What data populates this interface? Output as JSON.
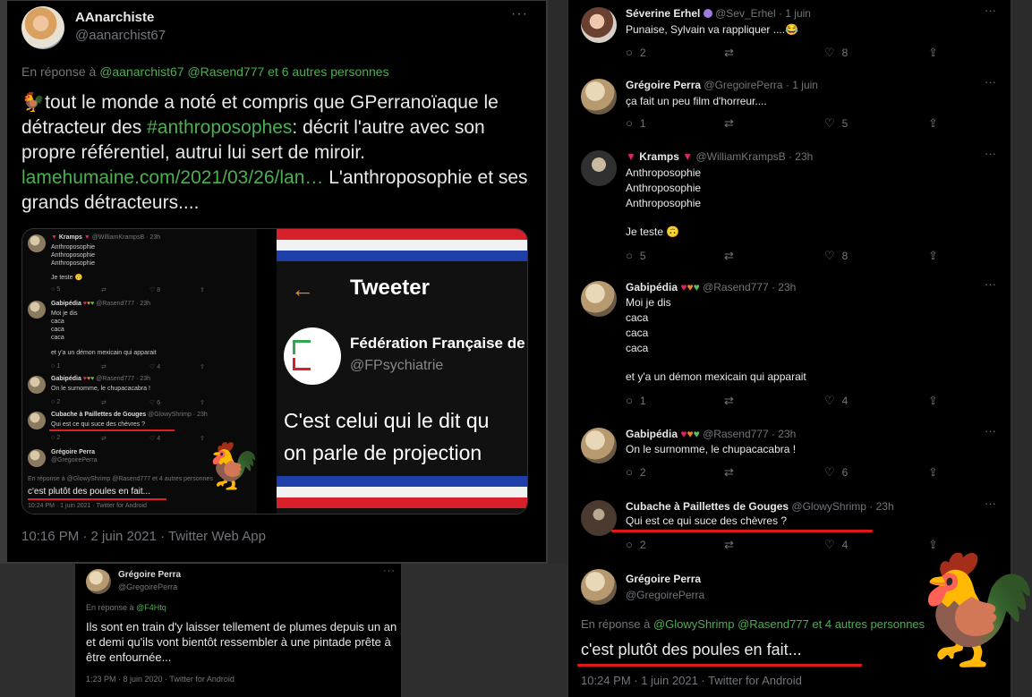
{
  "main_tweet": {
    "name": "AAnarchiste",
    "handle": "@aanarchist67",
    "reply_prefix": "En réponse à",
    "reply_mentions": "@aanarchist67 @Rasend777",
    "reply_more": "et 6 autres personnes",
    "text_part1": "🐓tout le monde a noté et compris que GPerranoïaque le détracteur des",
    "hashtag": "#anthroposophes",
    "text_part2": ": décrit l'autre avec son propre référentiel, autrui lui sert de miroir.",
    "link": "lamehumaine.com/2021/03/26/lan…",
    "text_part3": "L'anthroposophie et ses grands détracteurs....",
    "footer": "10:16 PM · 2 juin 2021 · Twitter Web App"
  },
  "media_mini": {
    "t1_name": "Kramps",
    "t1_handle": "@WilliamKrampsB · 23h",
    "t1_l1": "Anthroposophie",
    "t1_l2": "Anthroposophie",
    "t1_l3": "Anthroposophie",
    "t1_l4": "Je teste 🙃",
    "t1_counts": "5",
    "t1_likes": "8",
    "t2_name": "Gabipédia",
    "t2_handle": "@Rasend777 · 23h",
    "t2_l1": "Moi je dis",
    "t2_l2": "caca",
    "t2_l3": "caca",
    "t2_l4": "caca",
    "t2_l5": "et y'a un démon mexicain qui apparait",
    "t2_counts": "1",
    "t2_likes": "4",
    "t3_name": "Gabipédia",
    "t3_handle": "@Rasend777 · 23h",
    "t3_l1": "On le surnomme, le chupacacabra !",
    "t3_counts": "2",
    "t3_likes": "6",
    "t4_name": "Cubache à Paillettes de Gouges",
    "t4_handle": "@GlowyShrimp · 23h",
    "t4_l1": "Qui est ce qui suce des chèvres ?",
    "t4_counts": "2",
    "t4_likes": "4",
    "t5_name": "Grégoire Perra",
    "t5_handle": "@GregoirePerra",
    "t5_reply": "En réponse à @GlowyShrimp @Rasend777 et 4 autres personnes",
    "t5_text": "c'est plutôt des poules en fait...",
    "t5_footer": "10:24 PM · 1 juin 2021 · Twitter for Android"
  },
  "media_ff": {
    "back": "←",
    "title": "Tweeter",
    "org_name": "Fédération Française de",
    "org_handle": "@FPsychiatrie",
    "quote_l1": "C'est celui qui le dit qu",
    "quote_l2": "on parle de projection"
  },
  "small_tweet": {
    "name": "Grégoire Perra",
    "handle": "@GregoirePerra",
    "reply_prefix": "En réponse à",
    "reply_mention": "@F4Htq",
    "text": "Ils sont en train d'y laisser tellement de plumes depuis un an et demi qu'ils vont bientôt ressembler à une pintade prête à être enfournée...",
    "footer": "1:23 PM · 8 juin 2020 · Twitter for Android"
  },
  "thread": {
    "t1": {
      "name": "Séverine Erhel",
      "handle": "@Sev_Erhel · 1 juin",
      "text": "Punaise, Sylvain va rappliquer ....😂",
      "replies": "2",
      "retweets": "",
      "likes": "8"
    },
    "t2": {
      "name": "Grégoire Perra",
      "handle": "@GregoirePerra · 1 juin",
      "text": "ça fait un peu film d'horreur....",
      "replies": "1",
      "retweets": "",
      "likes": "5"
    },
    "t3": {
      "name": "Kramps",
      "handle": "@WilliamKrampsB · 23h",
      "l1": "Anthroposophie",
      "l2": "Anthroposophie",
      "l3": "Anthroposophie",
      "l4": "Je teste 🙃",
      "replies": "5",
      "likes": "8"
    },
    "t4": {
      "name": "Gabipédia",
      "handle": "@Rasend777 · 23h",
      "l1": "Moi je dis",
      "l2": "caca",
      "l3": "caca",
      "l4": "caca",
      "l5": "et y'a un démon mexicain qui apparait",
      "replies": "1",
      "likes": "4"
    },
    "t5": {
      "name": "Gabipédia",
      "handle": "@Rasend777 · 23h",
      "text": "On le surnomme, le chupacacabra !",
      "replies": "2",
      "likes": "6"
    },
    "t6": {
      "name": "Cubache à Paillettes de Gouges",
      "handle": "@GlowyShrimp · 23h",
      "text": "Qui est ce qui suce des chèvres ?",
      "replies": "2",
      "likes": "4"
    },
    "t7": {
      "name": "Grégoire Perra",
      "handle": "@GregoirePerra",
      "reply_prefix": "En réponse à",
      "reply_mentions": "@GlowyShrimp @Rasend777",
      "reply_more": "et 4 autres personnes",
      "text": "c'est plutôt des poules en fait...",
      "footer": "10:24 PM · 1 juin 2021 · Twitter for Android"
    }
  },
  "icons": {
    "more": "···",
    "reply": "💬",
    "retweet": "⇄",
    "like": "♡",
    "share": "⇪",
    "rooster": "🐓"
  },
  "colors": {
    "accent_link": "#1d9bf0",
    "hashtag_link": "#4caf50",
    "underline": "#e01818"
  }
}
